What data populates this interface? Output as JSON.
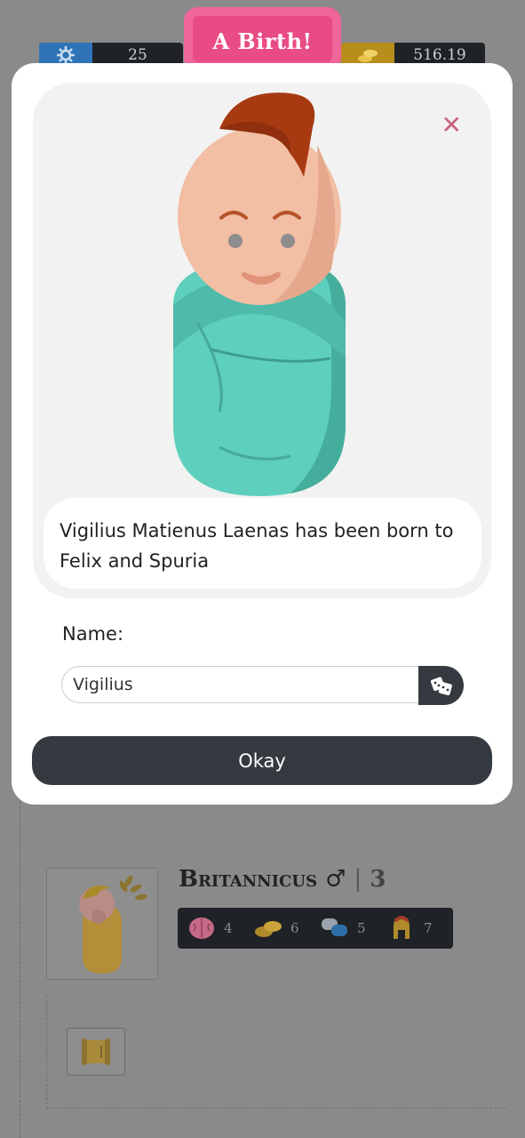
{
  "header": {
    "title": "A Birth!",
    "left_stat": {
      "icon": "gear-sun-icon",
      "value": "25",
      "color": "#2f74b8"
    },
    "right_stat": {
      "icon": "coins-icon",
      "value": "516.19",
      "color": "#b78d1c"
    }
  },
  "modal": {
    "close_icon": "close-icon",
    "message": "Vigilius Matienus Laenas has been born to Felix and Spuria",
    "name_label": "Name:",
    "name_value": "Vigilius",
    "randomize_icon": "dice-icon",
    "okay_label": "Okay"
  },
  "child": {
    "name": "Britannicus",
    "gender_symbol": "♂",
    "separator": "|",
    "age": "3",
    "stats": [
      {
        "icon": "brain-icon",
        "value": "4"
      },
      {
        "icon": "coins-icon",
        "value": "6"
      },
      {
        "icon": "speech-bubbles-icon",
        "value": "5"
      },
      {
        "icon": "helmet-icon",
        "value": "7"
      }
    ]
  },
  "colors": {
    "banner": "#e94b84",
    "button_dark": "#343a40",
    "blanket": "#5ecfbd",
    "close": "#c7607f"
  }
}
